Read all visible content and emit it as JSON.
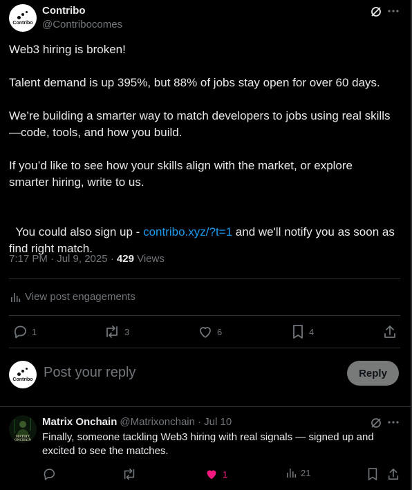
{
  "post": {
    "author_name": "Contribo",
    "author_handle": "@Contribocomes",
    "avatar_text": "Contribo",
    "paragraphs": [
      "Web3 hiring is broken!",
      "Talent demand is up 395%, but 88% of jobs stay open for over 60 days.",
      "We’re building a smarter way to match developers to jobs using real skills —code, tools, and how you build.",
      "If you’d like to see how your skills align with the market, or explore smarter hiring, write to us."
    ],
    "last_before": "You could also sign up - ",
    "last_link": "contribo.xyz/?t=1",
    "last_after": " and we'll notify you as soon as find right match.",
    "timestamp": "7:17 PM · Jul 9, 2025 · ",
    "views_count": "429",
    "views_label": " Views",
    "engagements": "View post engagements",
    "stats": {
      "replies": "1",
      "reposts": "3",
      "likes": "6",
      "bookmarks": "4"
    }
  },
  "composer": {
    "placeholder": "Post your reply",
    "button": "Reply"
  },
  "reply": {
    "author_name": "Matrix Onchain",
    "author_handle": "@Matrixonchain",
    "date": "· Jul 10",
    "avatar_text": "MATRIX ONCHAIN",
    "text": "Finally, someone tackling Web3 hiring with real signals — signed up and excited to see the matches.",
    "stats": {
      "likes": "1",
      "views": "21"
    }
  },
  "colors": {
    "accent": "#1d9bf0",
    "like": "#f91880",
    "muted": "#71767b"
  }
}
